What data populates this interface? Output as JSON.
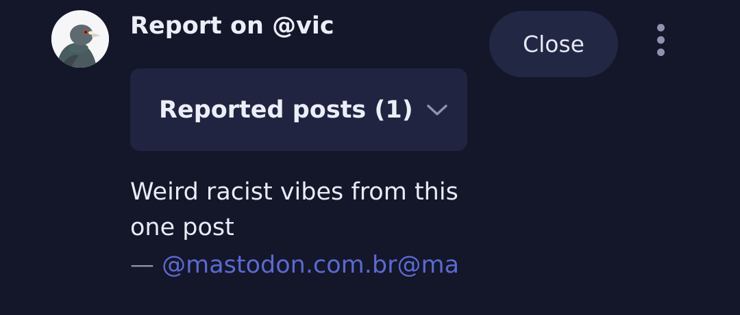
{
  "report": {
    "title": "Report on @vic",
    "close_label": "Close",
    "more_icon": "vertical-ellipsis-icon",
    "avatar_icon": "pigeon-avatar"
  },
  "reported_posts": {
    "label": "Reported posts (1)",
    "chevron_icon": "chevron-down-icon"
  },
  "comment": {
    "text": "Weird racist vibes from this one post",
    "dash": "—",
    "author_handle": "@mastodon.com.br@ma"
  },
  "colors": {
    "background": "#14162a",
    "card": "#202440",
    "link": "#5b6ad0",
    "text": "#eceef7"
  }
}
